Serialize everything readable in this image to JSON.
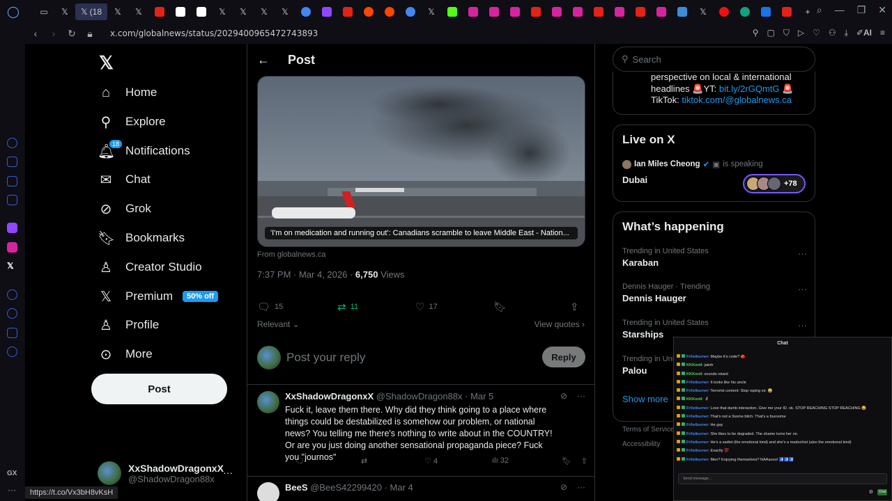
{
  "browser": {
    "active_tab_label": "(18",
    "url": "x.com/globalnews/status/2029400965472743893",
    "ai_label": "AI",
    "status_link": "https://t.co/Vx3bH8vKsH",
    "gx_label": "GX"
  },
  "nav": {
    "home": "Home",
    "explore": "Explore",
    "notifications": "Notifications",
    "notifications_badge": "18",
    "chat": "Chat",
    "grok": "Grok",
    "bookmarks": "Bookmarks",
    "creator_studio": "Creator Studio",
    "premium": "Premium",
    "premium_badge": "50% off",
    "profile": "Profile",
    "more": "More",
    "post_button": "Post",
    "account_name": "XxShadowDragonxX",
    "account_handle": "@ShadowDragon88x"
  },
  "post": {
    "header_title": "Post",
    "card_caption": "'I'm on medication and running out': Canadians scramble to leave Middle East - Nation...",
    "card_source": "From globalnews.ca",
    "timestamp": "7:37 PM · Mar 4, 2026 · ",
    "views_count": "6,750",
    "views_label": " Views",
    "replies": "15",
    "reposts": "11",
    "likes": "17",
    "relevant_label": "Relevant",
    "view_quotes": "View quotes",
    "reply_placeholder": "Post your reply",
    "reply_button": "Reply"
  },
  "replies": [
    {
      "name": "XxShadowDragonxX",
      "handle": "@ShadowDragon88x · Mar 5",
      "text": "Fuck it, leave them there. Why did they think going to a place where things could be destabilized is somehow our problem, or national news? You telling me there's nothing to write about in the COUNTRY! Or are you just doing another sensational propaganda piece? Fuck you \"journos\"",
      "likes": "4",
      "views": "32"
    },
    {
      "name": "BeeS",
      "handle": "@BeeS42299420 · Mar 4"
    }
  ],
  "right": {
    "search_placeholder": "Search",
    "bio_line1": "perspective on local & international",
    "bio_line2_prefix": "headlines 🚨YT: ",
    "bio_line2_link": "bit.ly/2rGQmtG",
    "bio_line2_suffix": " 🚨",
    "bio_line3_prefix": "TikTok: ",
    "bio_line3_link": "tiktok.com/@globalnews.ca",
    "live_title": "Live on X",
    "live_host": "Ian Miles Cheong",
    "live_status": "is speaking",
    "live_room": "Dubai",
    "live_listeners": "+78",
    "happening_title": "What’s happening",
    "trends": [
      {
        "context": "Trending in United States",
        "title": "Karaban"
      },
      {
        "context": "Dennis Hauger · Trending",
        "title": "Dennis Hauger"
      },
      {
        "context": "Trending in United States",
        "title": "Starships"
      },
      {
        "context": "Trending in United States",
        "title": "Palou"
      }
    ],
    "show_more": "Show more",
    "footer1": "Terms of Service",
    "footer2": "Accessibility"
  },
  "chat": {
    "title": "Chat",
    "input_placeholder": "Send message...",
    "send_label": "Chat",
    "messages": [
      {
        "user": "Fr0stburner",
        "text": ": Maybe it's code? 🍅"
      },
      {
        "user": "KKKontI",
        "text": ": jaiioh"
      },
      {
        "user": "KKKontI",
        "text": ": sounds retard"
      },
      {
        "user": "Fr0stburner",
        "text": ": It looks like his uncle"
      },
      {
        "user": "Fr0stburner",
        "text": ": Terrorist content: Stop raping sir. 😂"
      },
      {
        "user": "KKKontI",
        "text": ": 🦸"
      },
      {
        "user": "Fr0stburner",
        "text": ": Love that dumb interaction. Give me your ID. ok. STOP REACHING STOP REACHING 😂"
      },
      {
        "user": "Fr0stburner",
        "text": ": That's not a 3some bitch. That's a foursome"
      },
      {
        "user": "Fr0stburner",
        "text": ": He gay"
      },
      {
        "user": "Fr0stburner",
        "text": ": She likes to be degraded. The shame turns her on."
      },
      {
        "user": "Fr0stburner",
        "text": ": He's a sadist (the emotional kind) and she's a madochist (also the emotional kind)"
      },
      {
        "user": "Fr0stburner",
        "text": ": Exactly 💯"
      },
      {
        "user": "Fr0stburner",
        "text": ": Men? Enjoying themselves? NAAaooo! 🚮🚮🚮"
      }
    ]
  },
  "colors": {
    "accent": "#1d9bf0",
    "repost_active": "#00ba7c",
    "background": "#000000",
    "border": "#2f3336"
  }
}
